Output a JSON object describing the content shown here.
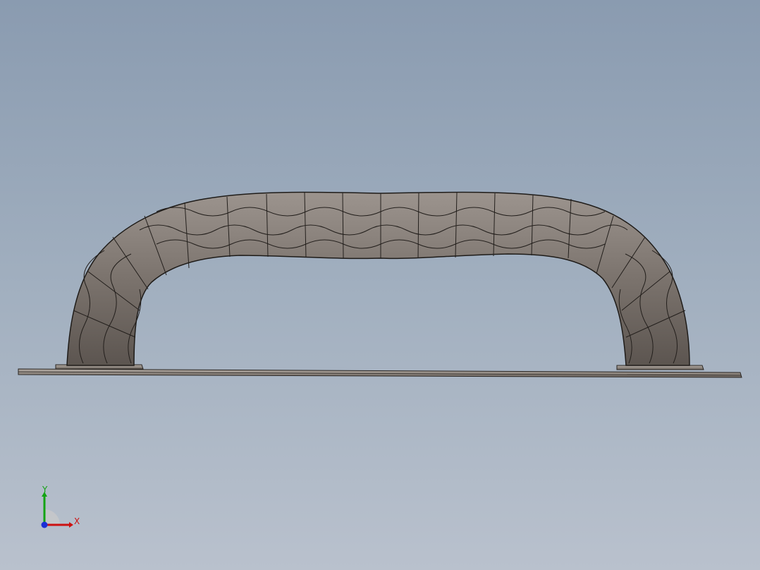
{
  "viewport": {
    "background_top": "#8a9bb0",
    "background_bottom": "#b9c1cd",
    "model_color": "#7b736d",
    "edge_color": "#1e1b18"
  },
  "triad": {
    "x_label": "X",
    "y_label": "Y",
    "x_color": "#cc1111",
    "y_color": "#13a313",
    "z_color": "#1b2fd6"
  }
}
